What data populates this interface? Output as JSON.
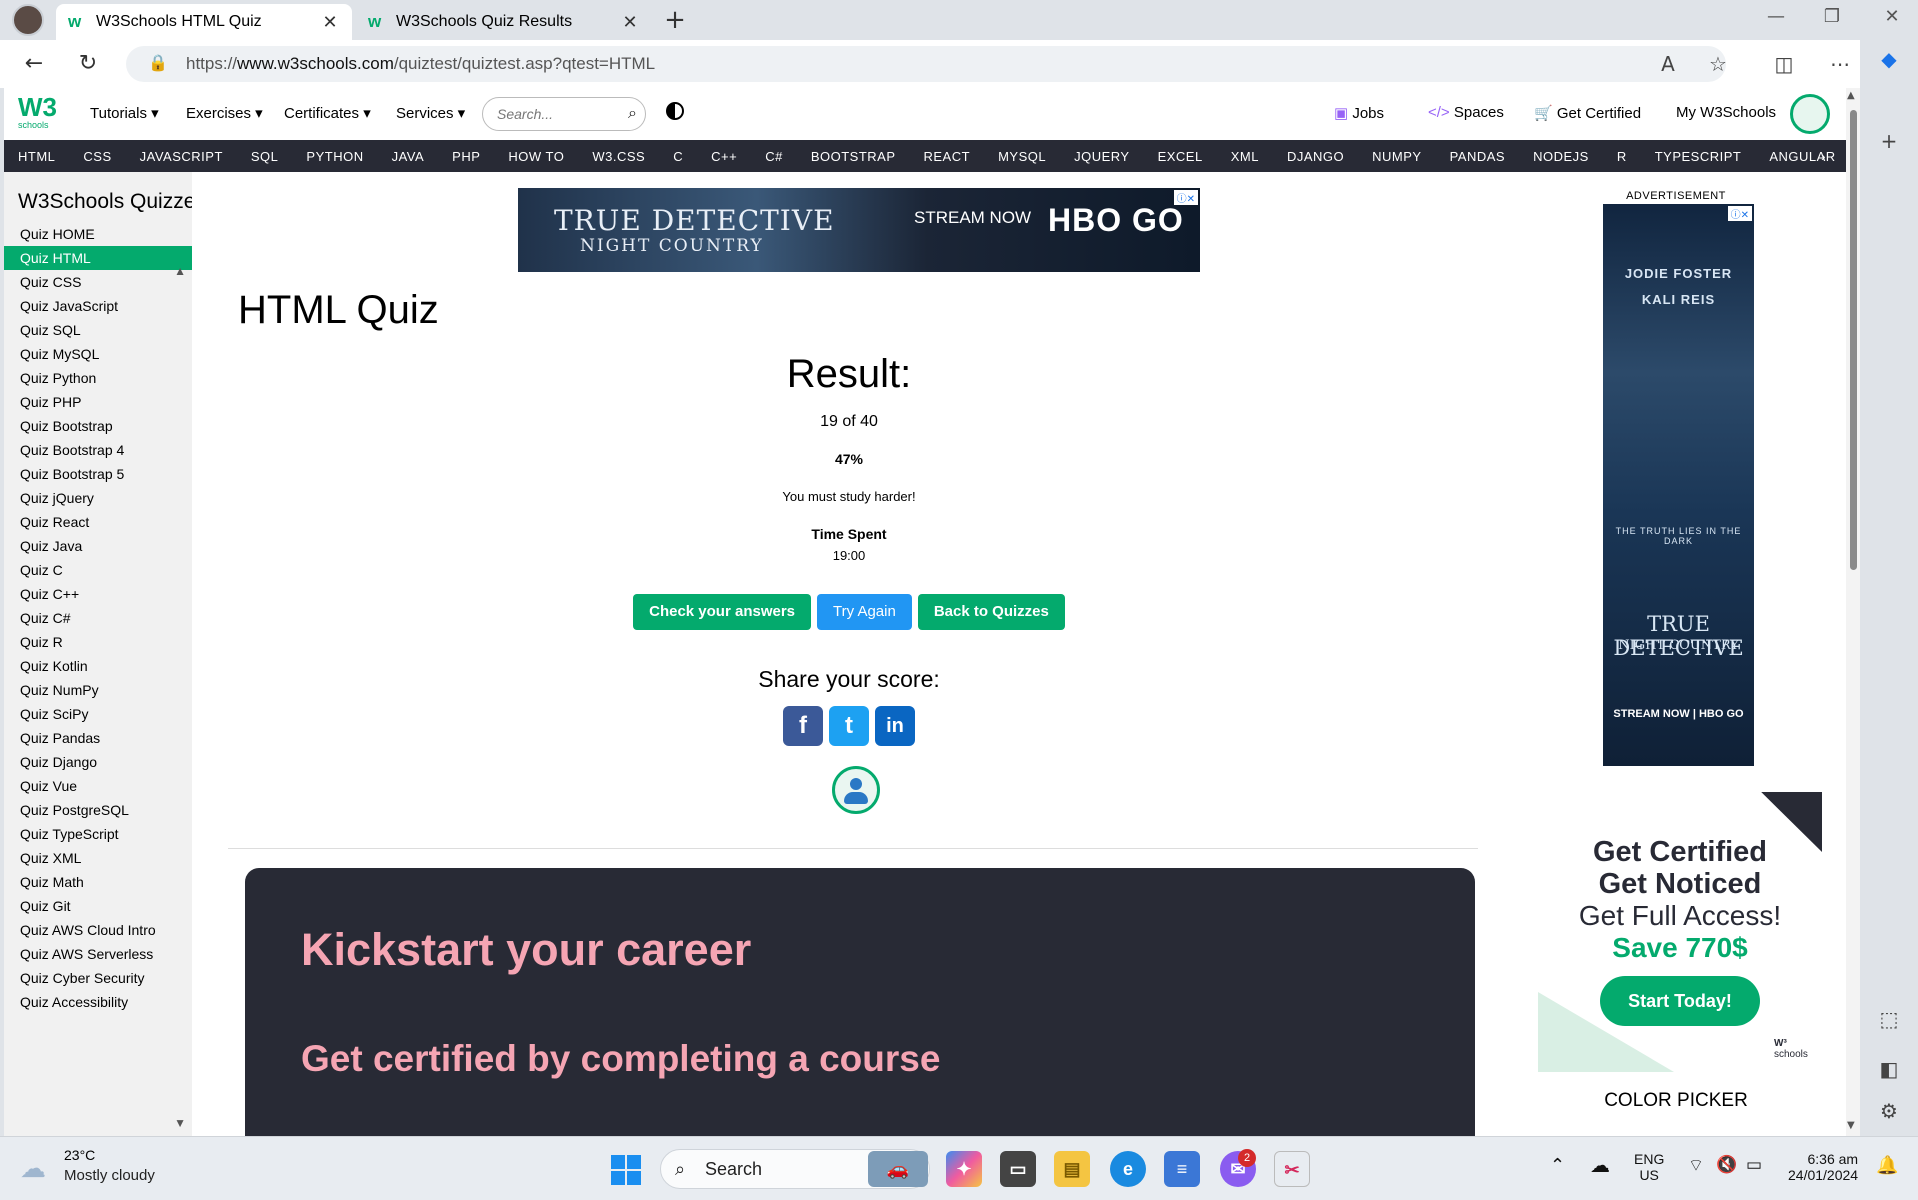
{
  "browser": {
    "tabs": [
      {
        "title": "W3Schools HTML Quiz",
        "active": true
      },
      {
        "title": "W3Schools Quiz Results",
        "active": false
      }
    ],
    "url_prefix": "https://",
    "url_domain": "www.w3schools.com",
    "url_path": "/quiztest/quiztest.asp?qtest=HTML"
  },
  "topnav": {
    "logo_mark": "W3",
    "logo_text": "schools",
    "menus": [
      "Tutorials ▾",
      "Exercises ▾",
      "Certificates ▾",
      "Services ▾"
    ],
    "search_placeholder": "Search...",
    "right_links": [
      "Jobs",
      "Spaces",
      "Get Certified",
      "My W3Schools"
    ]
  },
  "langbar": [
    "HTML",
    "CSS",
    "JAVASCRIPT",
    "SQL",
    "PYTHON",
    "JAVA",
    "PHP",
    "HOW TO",
    "W3.CSS",
    "C",
    "C++",
    "C#",
    "BOOTSTRAP",
    "REACT",
    "MYSQL",
    "JQUERY",
    "EXCEL",
    "XML",
    "DJANGO",
    "NUMPY",
    "PANDAS",
    "NODEJS",
    "R",
    "TYPESCRIPT",
    "ANGULAR"
  ],
  "sidebar": {
    "title": "W3Schools Quizzes",
    "items": [
      "Quiz HOME",
      "Quiz HTML",
      "Quiz CSS",
      "Quiz JavaScript",
      "Quiz SQL",
      "Quiz MySQL",
      "Quiz Python",
      "Quiz PHP",
      "Quiz Bootstrap",
      "Quiz Bootstrap 4",
      "Quiz Bootstrap 5",
      "Quiz jQuery",
      "Quiz React",
      "Quiz Java",
      "Quiz C",
      "Quiz C++",
      "Quiz C#",
      "Quiz R",
      "Quiz Kotlin",
      "Quiz NumPy",
      "Quiz SciPy",
      "Quiz Pandas",
      "Quiz Django",
      "Quiz Vue",
      "Quiz PostgreSQL",
      "Quiz TypeScript",
      "Quiz XML",
      "Quiz Math",
      "Quiz Git",
      "Quiz AWS Cloud Intro",
      "Quiz AWS Serverless",
      "Quiz Cyber Security",
      "Quiz Accessibility"
    ],
    "active_index": 1
  },
  "banner": {
    "line1": "TRUE DETECTIVE",
    "line2": "NIGHT COUNTRY",
    "cta": "STREAM NOW",
    "brand": "HBO GO"
  },
  "main": {
    "title": "HTML Quiz",
    "result_heading": "Result:",
    "score": "19 of 40",
    "percent": "47%",
    "message": "You must study harder!",
    "time_label": "Time Spent",
    "time_value": "19:00",
    "buttons": {
      "check": "Check your answers",
      "try": "Try Again",
      "back": "Back to Quizzes"
    },
    "share_heading": "Share your score:",
    "social": {
      "facebook": "f",
      "twitter": "t",
      "linkedin": "in"
    }
  },
  "career": {
    "heading": "Kickstart your career",
    "subheading": "Get certified by completing a course"
  },
  "right": {
    "ad_label": "ADVERTISEMENT",
    "sky": {
      "actor1": "JODIE FOSTER",
      "actor2": "KALI REIS",
      "tagline": "THE TRUTH LIES IN THE DARK",
      "title1": "TRUE DETECTIVE",
      "title2": "NIGHT COUNTRY",
      "cta": "STREAM NOW | HBO GO"
    },
    "cert": {
      "l1": "Get Certified",
      "l2": "Get Noticed",
      "l3": "Get Full Access!",
      "l4": "Save 770$",
      "button": "Start Today!",
      "mini": "schools"
    },
    "color_picker": "COLOR PICKER"
  },
  "taskbar": {
    "temp": "23°C",
    "weather": "Mostly cloudy",
    "search": "Search",
    "lang1": "ENG",
    "lang2": "US",
    "time": "6:36 am",
    "date": "24/01/2024",
    "messenger_badge": "2"
  }
}
